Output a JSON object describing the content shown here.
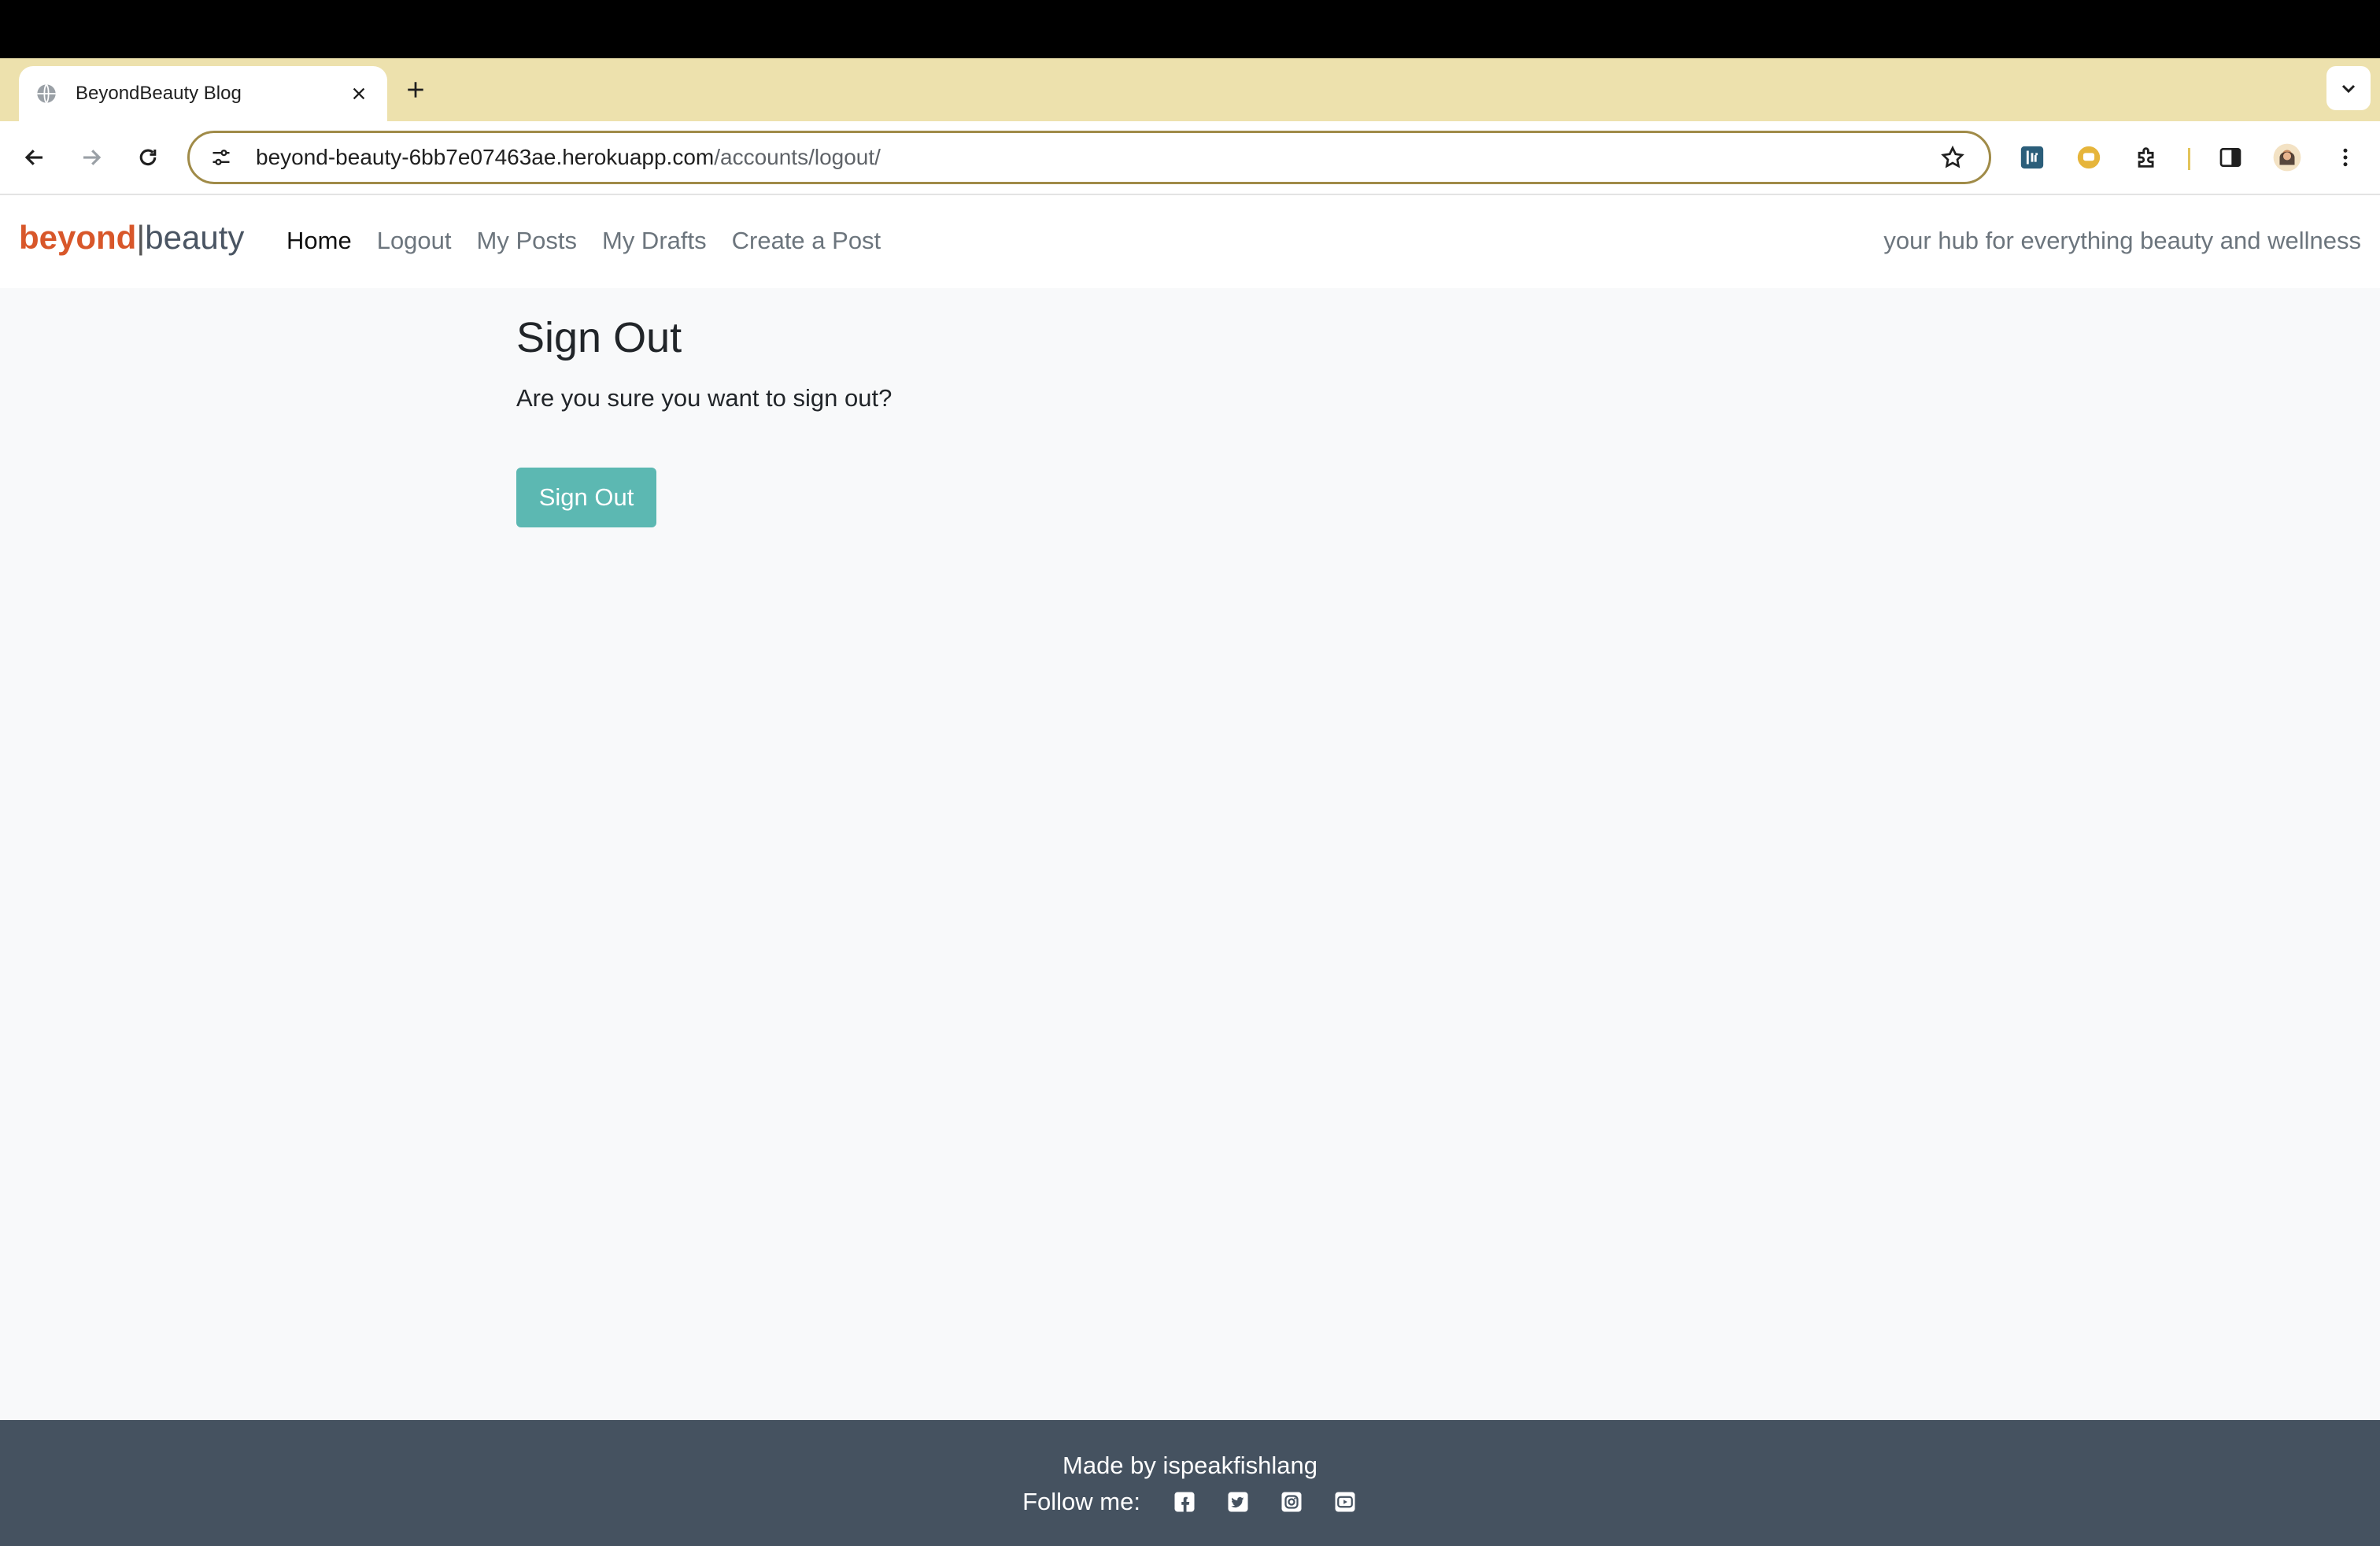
{
  "browser": {
    "tab_title": "BeyondBeauty Blog",
    "url_host": "beyond-beauty-6bb7e07463ae.herokuapp.com",
    "url_path": "/accounts/logout/",
    "accent_color": "#ede1ad"
  },
  "site": {
    "brand_primary": "beyond",
    "brand_separator": "|",
    "brand_secondary": "beauty",
    "brand_color": "#d8572a",
    "nav": [
      "Home",
      "Logout",
      "My Posts",
      "My Drafts",
      "Create a Post"
    ],
    "active_nav": "Home",
    "tagline": "your hub for everything beauty and wellness"
  },
  "main": {
    "heading": "Sign Out",
    "prompt": "Are you sure you want to sign out?",
    "button_label": "Sign Out",
    "button_color": "#5cb8b2"
  },
  "footer": {
    "made_by": "Made by ispeakfishlang",
    "follow_label": "Follow me:",
    "social_icons": [
      "facebook-icon",
      "twitter-icon",
      "instagram-icon",
      "youtube-icon"
    ]
  }
}
